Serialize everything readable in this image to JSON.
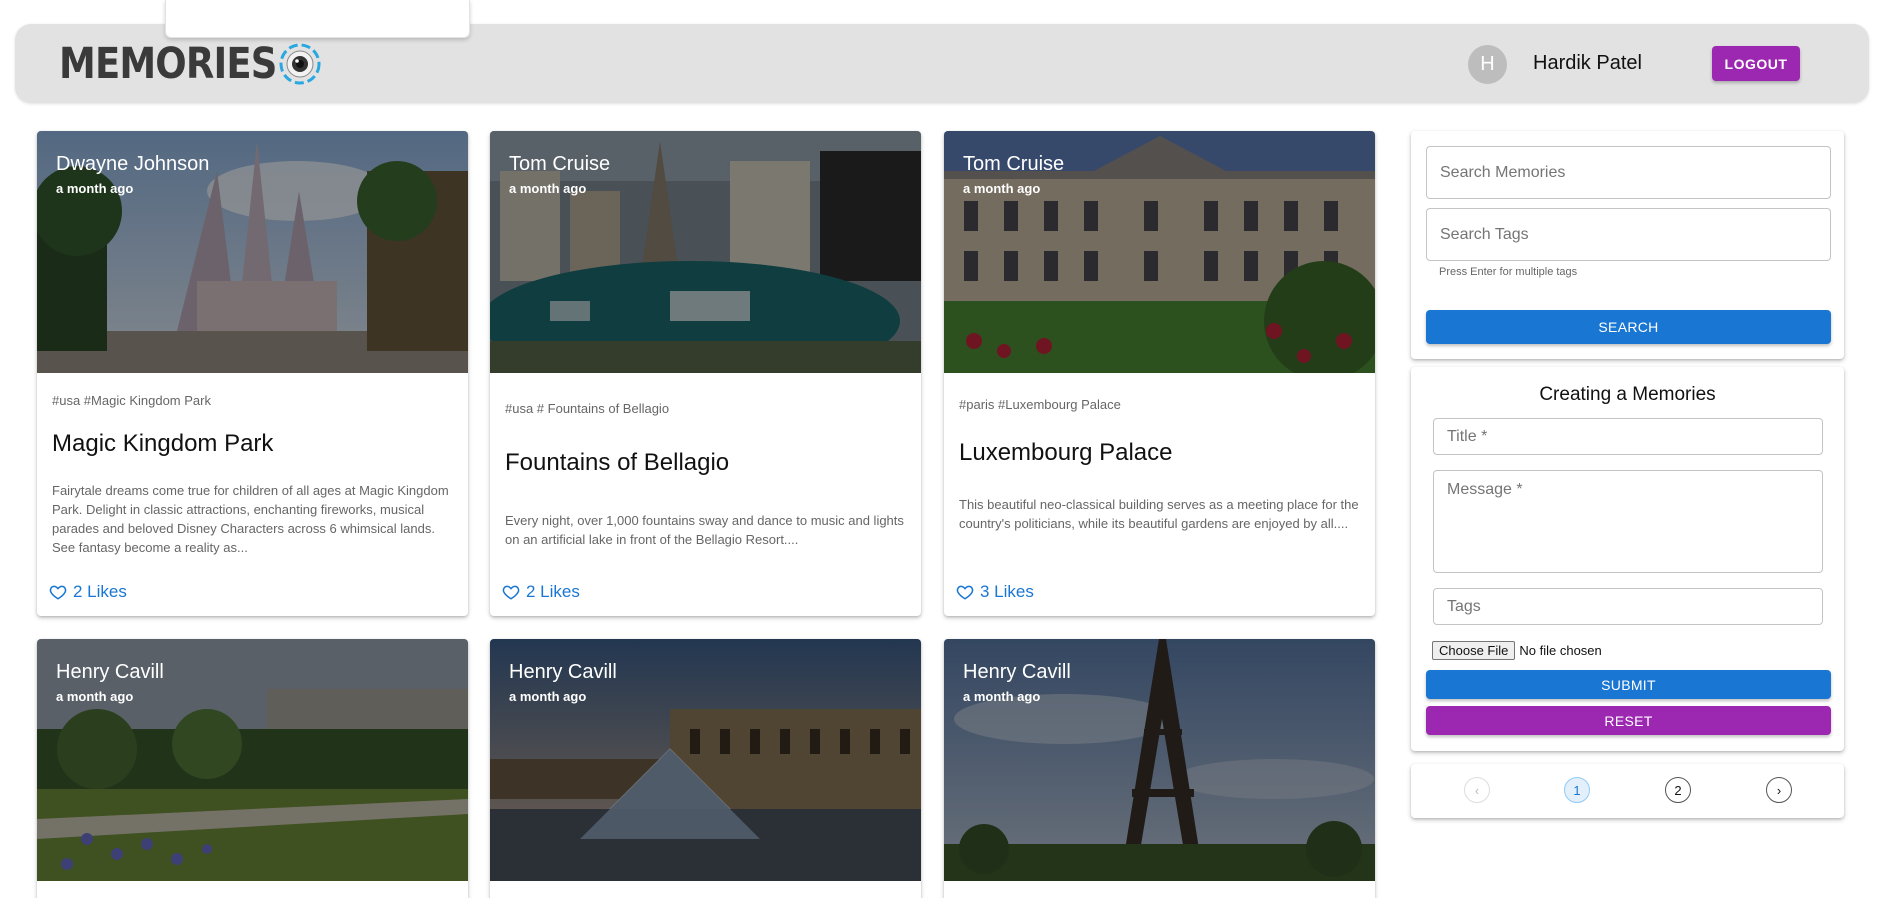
{
  "header": {
    "brand": "MEMORIES",
    "user_initial": "H",
    "user_name": "Hardik Patel",
    "logout_label": "LOGOUT"
  },
  "posts": [
    {
      "author": "Dwayne Johnson",
      "time": "a month ago",
      "tags": "#usa #Magic Kingdom Park",
      "title": "Magic Kingdom Park",
      "message": "Fairytale dreams come true for children of all ages at Magic Kingdom Park. Delight in classic attractions, enchanting fireworks, musical parades and beloved Disney Characters across 6 whimsical lands. See fantasy become a reality as...",
      "likes": "2 Likes",
      "image": "castle-photo"
    },
    {
      "author": "Tom Cruise",
      "time": "a month ago",
      "tags": "#usa # Fountains of Bellagio",
      "title": "Fountains of Bellagio",
      "message": "Every night, over 1,000 fountains sway and dance to music and lights on an artificial lake in front of the Bellagio Resort....",
      "likes": "2 Likes",
      "image": "fountains-photo"
    },
    {
      "author": "Tom Cruise",
      "time": "a month ago",
      "tags": "#paris #Luxembourg Palace",
      "title": "Luxembourg Palace",
      "message": "This beautiful neo-classical building serves as a meeting place for the country's politicians, while its beautiful gardens are enjoyed by all....",
      "likes": "3 Likes",
      "image": "palace-photo"
    },
    {
      "author": "Henry Cavill",
      "time": "a month ago",
      "image": "garden-photo"
    },
    {
      "author": "Henry Cavill",
      "time": "a month ago",
      "image": "louvre-photo"
    },
    {
      "author": "Henry Cavill",
      "time": "a month ago",
      "image": "eiffel-photo"
    }
  ],
  "search": {
    "memories_placeholder": "Search Memories",
    "tags_placeholder": "Search Tags",
    "helper": "Press Enter for multiple tags",
    "button": "SEARCH"
  },
  "form": {
    "title": "Creating a Memories",
    "title_label": "Title *",
    "message_label": "Message *",
    "tags_label": "Tags",
    "file_button": "Choose File",
    "file_status": "No file chosen",
    "submit": "SUBMIT",
    "reset": "RESET"
  },
  "pagination": {
    "prev": "‹",
    "pages": [
      "1",
      "2"
    ],
    "next": "›",
    "current_page": 1
  },
  "colors": {
    "primary": "#1976d2",
    "secondary": "#9c27b0",
    "appbar": "#e2e2e2"
  }
}
